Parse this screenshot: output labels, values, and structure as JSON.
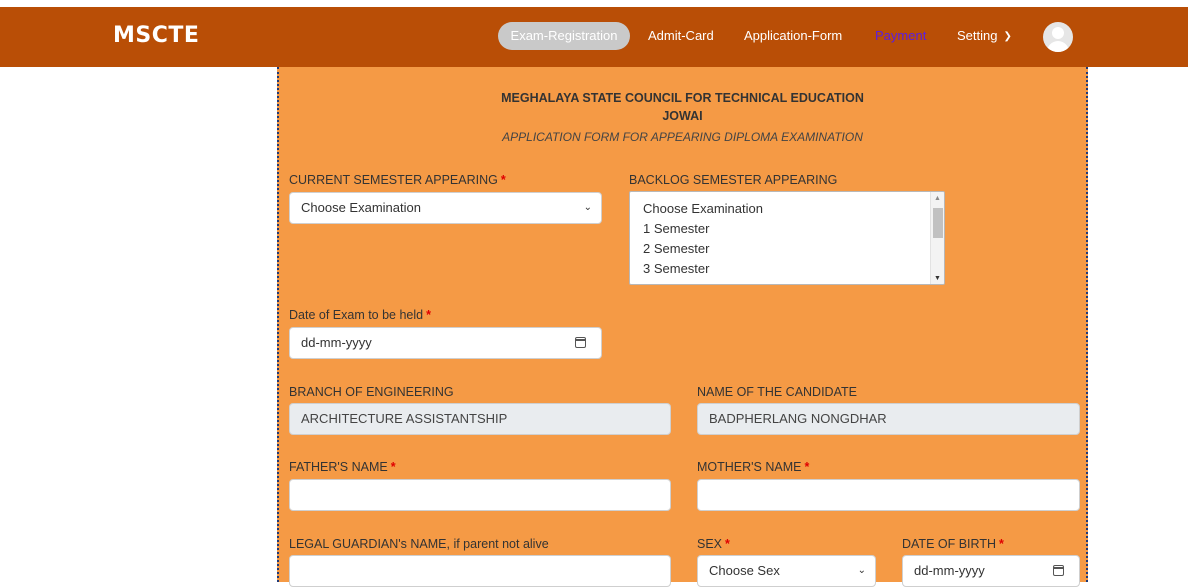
{
  "app": {
    "brand": "MSCTE"
  },
  "nav": {
    "exam_registration": "Exam-Registration",
    "admit_card": "Admit-Card",
    "application_form": "Application-Form",
    "payment": "Payment",
    "setting": "Setting",
    "setting_icon": "chevron-down-icon",
    "avatar_icon": "user-avatar-icon"
  },
  "header": {
    "line1": "MEGHALAYA STATE COUNCIL FOR TECHNICAL EDUCATION",
    "line2": "JOWAI",
    "line3": "APPLICATION FORM FOR APPEARING DIPLOMA EXAMINATION"
  },
  "form": {
    "current_semester": {
      "label": "CURRENT SEMESTER APPEARING",
      "required_mark": "*",
      "value": "Choose Examination"
    },
    "backlog_semester": {
      "label": "BACKLOG SEMESTER APPEARING",
      "options": [
        "Choose Examination",
        "1 Semester",
        "2 Semester",
        "3 Semester"
      ]
    },
    "exam_date": {
      "label": "Date of Exam to be held",
      "required_mark": "*",
      "placeholder": "dd-mm-yyyy"
    },
    "branch": {
      "label": "BRANCH OF ENGINEERING",
      "value": "ARCHITECTURE ASSISTANTSHIP"
    },
    "candidate": {
      "label": "NAME OF THE CANDIDATE",
      "value": "BADPHERLANG NONGDHAR"
    },
    "father": {
      "label": "FATHER'S NAME",
      "required_mark": "*",
      "value": ""
    },
    "mother": {
      "label": "MOTHER'S NAME",
      "required_mark": "*",
      "value": ""
    },
    "guardian": {
      "label": "LEGAL GUARDIAN's NAME, if parent not alive",
      "value": ""
    },
    "sex": {
      "label": "SEX",
      "required_mark": "*",
      "value": "Choose Sex"
    },
    "dob": {
      "label": "DATE OF BIRTH",
      "required_mark": "*",
      "placeholder": "dd-mm-yyyy"
    }
  },
  "colors": {
    "topbar": "#b94e06",
    "panel": "#f59a45",
    "payment_link": "#5a1fe0",
    "required": "#e00000"
  }
}
